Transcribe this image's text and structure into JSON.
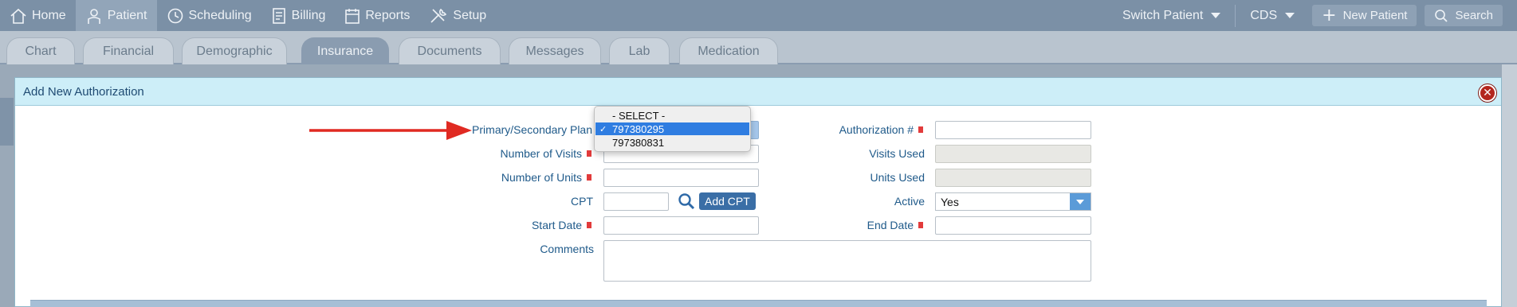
{
  "nav": {
    "items": [
      {
        "label": "Home",
        "icon": "home-icon"
      },
      {
        "label": "Patient",
        "icon": "user-icon"
      },
      {
        "label": "Scheduling",
        "icon": "clock-icon"
      },
      {
        "label": "Billing",
        "icon": "receipt-icon"
      },
      {
        "label": "Reports",
        "icon": "calendar-icon"
      },
      {
        "label": "Setup",
        "icon": "tools-icon"
      }
    ],
    "active": "Patient",
    "switch_patient": "Switch Patient",
    "cds": "CDS",
    "new_patient": "New Patient",
    "search": "Search"
  },
  "tabs": {
    "items": [
      "Chart",
      "Financial",
      "Demographic",
      "Insurance",
      "Documents",
      "Messages",
      "Lab",
      "Medication"
    ],
    "active": "Insurance"
  },
  "modal": {
    "title": "Add New Authorization",
    "labels": {
      "plan": "Primary/Secondary Plan",
      "num_visits": "Number of Visits",
      "num_units": "Number of Units",
      "cpt": "CPT",
      "start_date": "Start Date",
      "comments": "Comments",
      "auth_num": "Authorization #",
      "visits_used": "Visits Used",
      "units_used": "Units Used",
      "active": "Active",
      "end_date": "End Date"
    },
    "add_cpt": "Add CPT",
    "active_value": "Yes",
    "plan_options": [
      "- SELECT -",
      "797380295",
      "797380831"
    ],
    "plan_selected": "797380295"
  },
  "colors": {
    "accent": "#3a6ea6",
    "required": "#e23b3b",
    "arrow": "#e02a22",
    "header_bg": "#cdeef8"
  }
}
